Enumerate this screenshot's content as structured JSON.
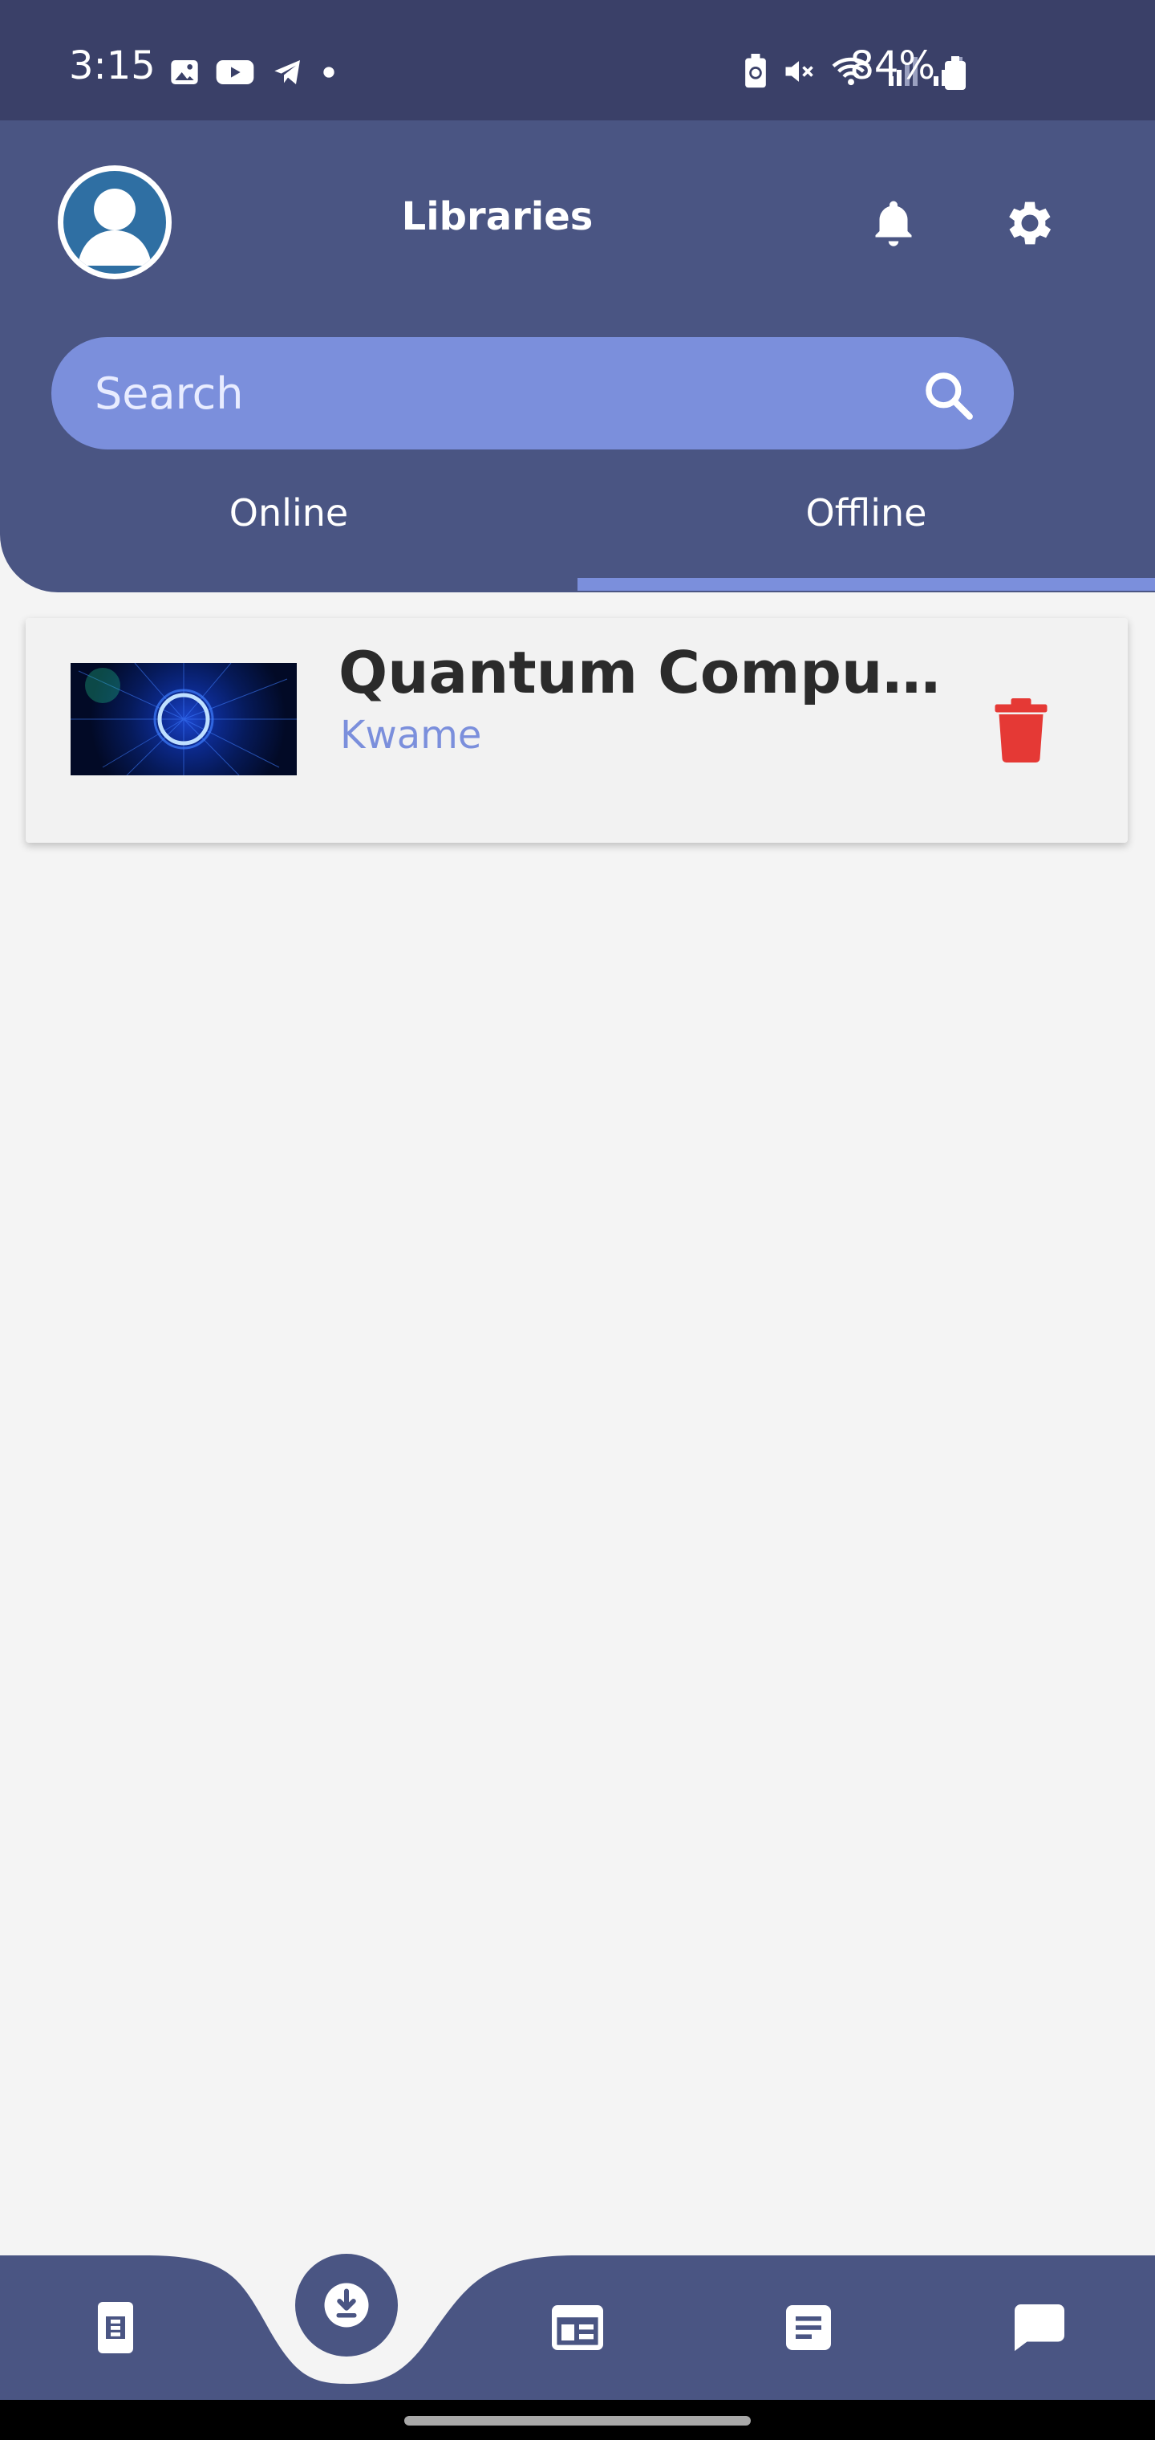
{
  "status_bar": {
    "time": "3:15",
    "battery_text": "84%",
    "left_icons": [
      "gallery-icon",
      "youtube-icon",
      "telegram-icon",
      "dot-icon"
    ],
    "right_icons": [
      "battery-saver-icon",
      "mute-icon",
      "wifi-icon",
      "signal-icon",
      "signal-icon",
      "battery-icon"
    ]
  },
  "header": {
    "title": "Libraries",
    "avatar_icon": "user-avatar-icon",
    "notification_icon": "bell-icon",
    "settings_icon": "gear-icon"
  },
  "search": {
    "placeholder": "Search",
    "value": ""
  },
  "tabs": [
    {
      "label": "Online",
      "selected": false
    },
    {
      "label": "Offline",
      "selected": true
    }
  ],
  "items": [
    {
      "title": "Quantum Comput...",
      "author": "Kwame",
      "thumbnail_icon": "quantum-thumbnail",
      "action_icon": "trash-icon"
    }
  ],
  "bottom_nav": {
    "items": [
      "book-icon",
      "download-icon",
      "layout-icon",
      "document-icon",
      "chat-icon"
    ],
    "active": "download-icon"
  },
  "colors": {
    "status_bar": "#3a4068",
    "header": "#4a5583",
    "accent": "#7b8fdc",
    "background": "#f4f4f4",
    "delete": "#e53935",
    "title_text": "#2b2b2b"
  }
}
